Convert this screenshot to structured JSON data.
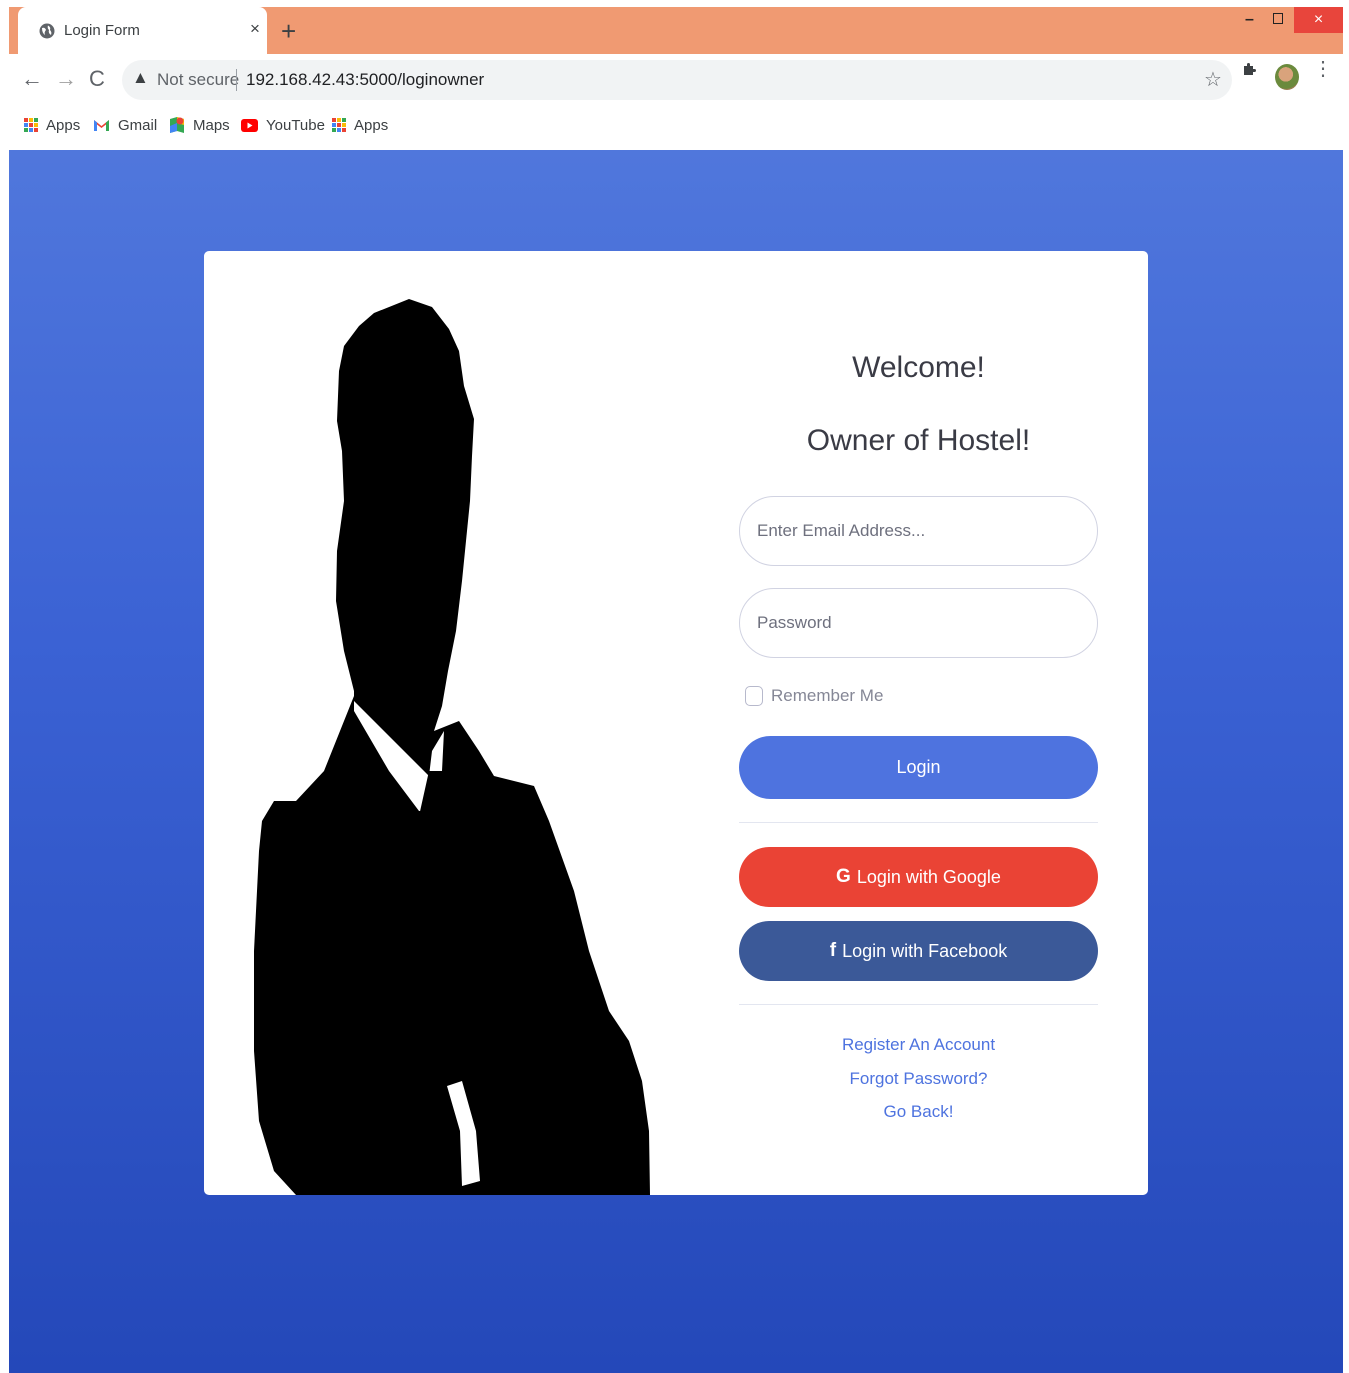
{
  "browser": {
    "tab_title": "Login Form",
    "tab_close": "×",
    "new_tab": "+",
    "window_minimize": "–",
    "window_close": "×",
    "not_secure": "Not secure",
    "url": "192.168.42.43:5000/loginowner",
    "back": "←",
    "forward": "→",
    "reload": "C",
    "warning": "▲",
    "star": "☆",
    "menu": "⋮"
  },
  "bookmarks": [
    {
      "label": "Apps",
      "icon": "apps-grid-icon"
    },
    {
      "label": "Gmail",
      "icon": "gmail-icon"
    },
    {
      "label": "Maps",
      "icon": "maps-icon"
    },
    {
      "label": "YouTube",
      "icon": "youtube-icon"
    },
    {
      "label": "Apps",
      "icon": "apps-grid-icon"
    }
  ],
  "login": {
    "welcome": "Welcome!",
    "owner": "Owner of Hostel!",
    "email_placeholder": "Enter Email Address...",
    "password_placeholder": "Password",
    "remember_me": "Remember Me",
    "login_button": "Login",
    "google_button": "Login with Google",
    "google_icon": "G",
    "facebook_button": "Login with Facebook",
    "facebook_icon": "f",
    "register_link": "Register An Account",
    "forgot_link": "Forgot Password?",
    "back_link": "Go Back!"
  },
  "colors": {
    "tabstrip": "#f09a72",
    "page_gradient_top": "#5077dc",
    "page_gradient_bottom": "#2448b9",
    "primary": "#4e73df",
    "google": "#ea4335",
    "facebook": "#3b5998"
  }
}
